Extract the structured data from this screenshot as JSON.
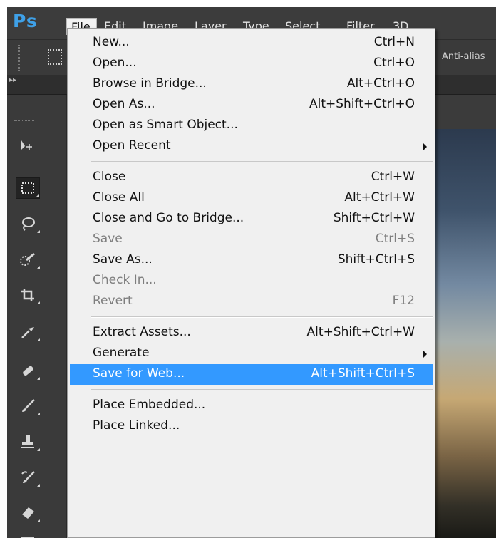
{
  "app": {
    "logo": "Ps"
  },
  "menubar": {
    "items": [
      "File",
      "Edit",
      "Image",
      "Layer",
      "Type",
      "Select",
      "Filter",
      "3D"
    ]
  },
  "options_bar": {
    "anti_alias_label": "Anti-alias"
  },
  "file_menu": {
    "items": [
      {
        "label": "New...",
        "shortcut": "Ctrl+N"
      },
      {
        "label": "Open...",
        "shortcut": "Ctrl+O"
      },
      {
        "label": "Browse in Bridge...",
        "shortcut": "Alt+Ctrl+O"
      },
      {
        "label": "Open As...",
        "shortcut": "Alt+Shift+Ctrl+O"
      },
      {
        "label": "Open as Smart Object...",
        "shortcut": ""
      },
      {
        "label": "Open Recent",
        "shortcut": ""
      },
      {
        "label": "Close",
        "shortcut": "Ctrl+W"
      },
      {
        "label": "Close All",
        "shortcut": "Alt+Ctrl+W"
      },
      {
        "label": "Close and Go to Bridge...",
        "shortcut": "Shift+Ctrl+W"
      },
      {
        "label": "Save",
        "shortcut": "Ctrl+S"
      },
      {
        "label": "Save As...",
        "shortcut": "Shift+Ctrl+S"
      },
      {
        "label": "Check In...",
        "shortcut": ""
      },
      {
        "label": "Revert",
        "shortcut": "F12"
      },
      {
        "label": "Extract Assets...",
        "shortcut": "Alt+Shift+Ctrl+W"
      },
      {
        "label": "Generate",
        "shortcut": ""
      },
      {
        "label": "Save for Web...",
        "shortcut": "Alt+Shift+Ctrl+S"
      },
      {
        "label": "Place Embedded...",
        "shortcut": ""
      },
      {
        "label": "Place Linked...",
        "shortcut": ""
      }
    ]
  },
  "colors": {
    "logo": "#3fa1e8",
    "menu_highlight": "#3399ff",
    "menu_background": "#f0f0f0",
    "disabled_text": "#7e7e7e"
  },
  "toolbar": {
    "tools": [
      "move-tool-icon",
      "rectangular-marquee-icon",
      "lasso-icon",
      "quick-selection-icon",
      "crop-icon",
      "eyedropper-icon",
      "healing-brush-icon",
      "brush-icon",
      "clone-stamp-icon",
      "history-brush-icon",
      "eraser-icon",
      "gradient-icon"
    ]
  }
}
